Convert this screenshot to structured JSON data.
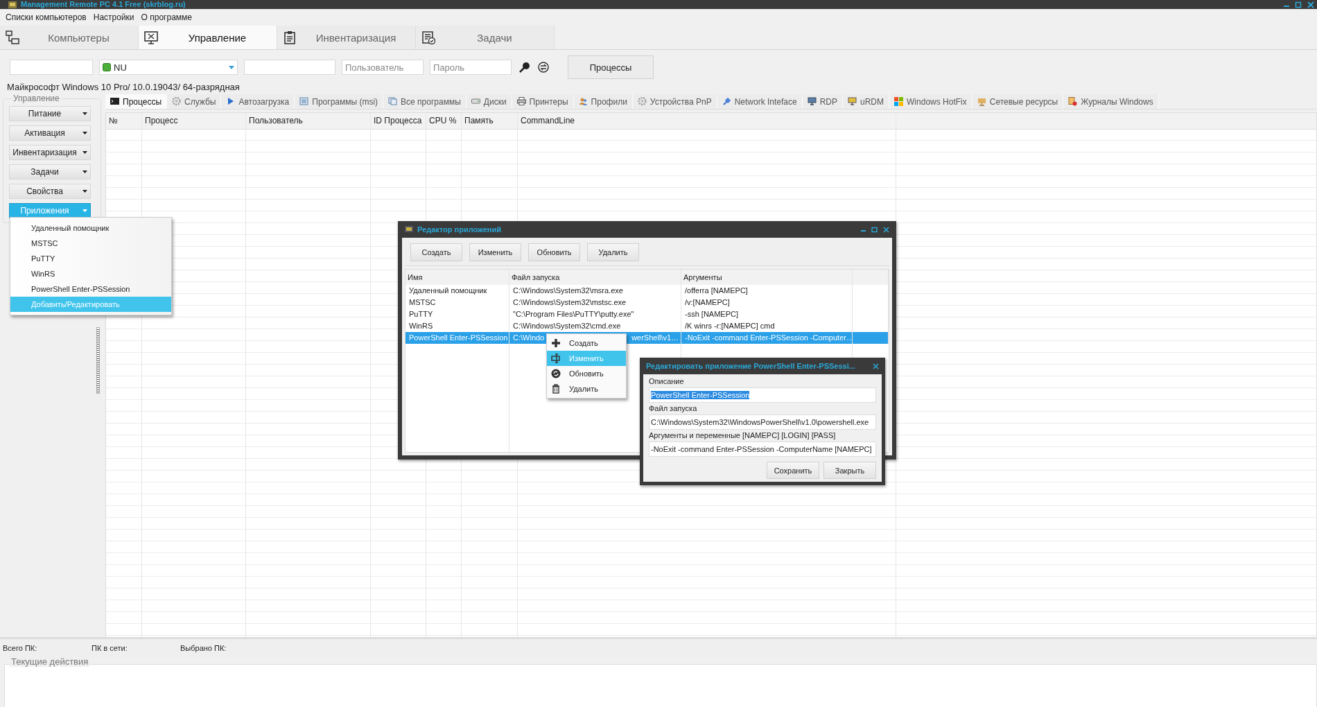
{
  "window": {
    "title": "Management Remote PC 4.1 Free (skrblog.ru)"
  },
  "menu": [
    "Списки компьютеров",
    "Настройки",
    "О программе"
  ],
  "main_tabs": [
    {
      "label": "Компьютеры",
      "selected": false
    },
    {
      "label": "Управление",
      "selected": true
    },
    {
      "label": "Инвентаризация",
      "selected": false
    },
    {
      "label": "Задачи",
      "selected": false
    }
  ],
  "toolbar": {
    "computer": {
      "value": "NU"
    },
    "user_field": {
      "placeholder": "Пользователь"
    },
    "password_field": {
      "placeholder": "Пароль"
    },
    "action_button": "Процессы"
  },
  "os_info": "Майкрософт Windows 10 Pro/  10.0.19043/ 64-разрядная",
  "side_panel": {
    "title": "Управление",
    "buttons": [
      {
        "label": "Питание",
        "selected": false
      },
      {
        "label": "Активация",
        "selected": false
      },
      {
        "label": "Инвентаризация",
        "selected": false
      },
      {
        "label": "Задачи",
        "selected": false
      },
      {
        "label": "Свойства",
        "selected": false
      },
      {
        "label": "Приложения",
        "selected": true
      }
    ]
  },
  "apps_menu": {
    "items": [
      {
        "label": "Удаленный помощник",
        "selected": false
      },
      {
        "label": "MSTSC",
        "selected": false
      },
      {
        "label": "PuTTY",
        "selected": false
      },
      {
        "label": "WinRS",
        "selected": false
      },
      {
        "label": "PowerShell Enter-PSSession",
        "selected": false
      },
      {
        "label": "Добавить/Редактировать",
        "selected": true
      }
    ]
  },
  "sub_tabs": [
    {
      "label": "Процессы",
      "selected": true
    },
    {
      "label": "Службы",
      "selected": false
    },
    {
      "label": "Автозагрузка",
      "selected": false
    },
    {
      "label": "Программы (msi)",
      "selected": false
    },
    {
      "label": "Все программы",
      "selected": false
    },
    {
      "label": "Диски",
      "selected": false
    },
    {
      "label": "Принтеры",
      "selected": false
    },
    {
      "label": "Профили",
      "selected": false
    },
    {
      "label": "Устройства PnP",
      "selected": false
    },
    {
      "label": "Network Inteface",
      "selected": false
    },
    {
      "label": "RDP",
      "selected": false
    },
    {
      "label": "uRDM",
      "selected": false
    },
    {
      "label": "Windows HotFix",
      "selected": false
    },
    {
      "label": "Сетевые ресурсы",
      "selected": false
    },
    {
      "label": "Журналы Windows",
      "selected": false
    }
  ],
  "process_table": {
    "columns": [
      "№",
      "Процесс",
      "Пользователь",
      "ID Процесса",
      "CPU %",
      "Память",
      "CommandLine"
    ]
  },
  "app_editor": {
    "title": "Редактор приложений",
    "buttons": [
      "Создать",
      "Изменить",
      "Обновить",
      "Удалить"
    ],
    "columns": [
      "Имя",
      "Файл запуска",
      "Аргументы"
    ],
    "rows": [
      {
        "cells": [
          "Удаленный помощник",
          "C:\\Windows\\System32\\msra.exe",
          "/offerra [NAMEPC]"
        ],
        "selected": false
      },
      {
        "cells": [
          "MSTSC",
          "C:\\Windows\\System32\\mstsc.exe",
          "/v:[NAMEPC]"
        ],
        "selected": false
      },
      {
        "cells": [
          "PuTTY",
          "\"C:\\Program Files\\PuTTY\\putty.exe\"",
          "-ssh [NAMEPC]"
        ],
        "selected": false
      },
      {
        "cells": [
          "WinRS",
          "C:\\Windows\\System32\\cmd.exe",
          "/K winrs -r:[NAMEPC] cmd"
        ],
        "selected": false
      },
      {
        "cells": [
          "PowerShell Enter-PSSession",
          [
            "C:\\Windo",
            "werShell\\v1…"
          ],
          "-NoExit -command Enter-PSSession -Computer…"
        ],
        "selected": true
      }
    ]
  },
  "context_menu": {
    "items": [
      {
        "label": "Создать",
        "selected": false
      },
      {
        "label": "Изменить",
        "selected": true
      },
      {
        "label": "Обновить",
        "selected": false
      },
      {
        "label": "Удалить",
        "selected": false
      }
    ]
  },
  "edit_dialog": {
    "title": "Редактировать приложение PowerShell Enter-PSSessi...",
    "fields": [
      {
        "label": "Описание",
        "value": "PowerShell Enter-PSSession",
        "selected": true
      },
      {
        "label": "Файл запуска",
        "value": "C:\\Windows\\System32\\WindowsPowerShell\\v1.0\\powershell.exe",
        "selected": false
      },
      {
        "label": "Аргументы и переменные [NAMEPC] [LOGIN] [PASS]",
        "value": "-NoExit -command Enter-PSSession -ComputerName [NAMEPC]",
        "selected": false
      }
    ],
    "buttons": [
      "Сохранить",
      "Закрыть"
    ]
  },
  "status_bar": [
    "Всего ПК:",
    "ПК в сети:",
    "Выбрано ПК:"
  ],
  "actions_panel": {
    "title": "Текущие действия"
  }
}
